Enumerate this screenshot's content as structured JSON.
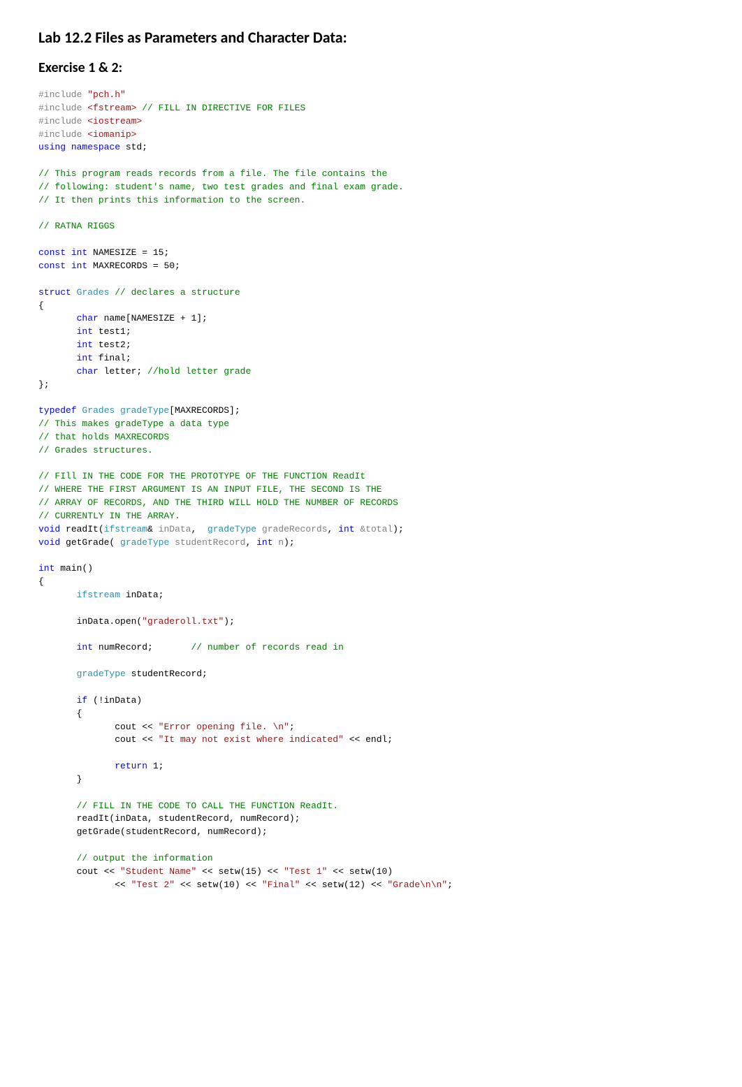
{
  "title": "Lab 12.2 Files as Parameters and Character Data:",
  "subtitle": "Exercise 1 & 2:",
  "code": {
    "l1a": "#include",
    "l1b": " \"pch.h\"",
    "l2a": "#include",
    "l2b": " <fstream>",
    "l2c": " // FILL IN DIRECTIVE FOR FILES",
    "l3a": "#include",
    "l3b": " <iostream>",
    "l4a": "#include",
    "l4b": " <iomanip>",
    "l5a": "using",
    "l5b": " namespace",
    "l5c": " std;",
    "c1": "// This program reads records from a file. The file contains the",
    "c2": "// following: student's name, two test grades and final exam grade.",
    "c3": "// It then prints this information to the screen.",
    "c4": "// RATNA RIGGS",
    "k_const": "const",
    "k_int": "int",
    "ns": " NAMESIZE = 15;",
    "mr": " MAXRECORDS = 50;",
    "k_struct": "struct",
    "t_grades": " Grades",
    "c5": " // declares a structure",
    "ob": "{",
    "k_char": "char",
    "nm": " name[NAMESIZE + 1];",
    "t1": " test1;",
    "t2": " test2;",
    "fn": " final;",
    "lt": " letter;",
    "c6": " //hold letter grade",
    "cb": "};",
    "k_typedef": "typedef",
    "t_gradeType": " gradeType",
    "arr": "[MAXRECORDS];",
    "c7": "// This makes gradeType a data type",
    "c8": "// that holds MAXRECORDS",
    "c9": "// Grades structures.",
    "c10": "// FIll IN THE CODE FOR THE PROTOTYPE OF THE FUNCTION ReadIt",
    "c11": "// WHERE THE FIRST ARGUMENT IS AN INPUT FILE, THE SECOND IS THE",
    "c12": "// ARRAY OF RECORDS, AND THE THIRD WILL HOLD THE NUMBER OF RECORDS",
    "c13": "// CURRENTLY IN THE ARRAY.",
    "k_void": "void",
    "readit": " readIt(",
    "t_ifstream": "ifstream",
    "amp": "& ",
    "p_inData": "inData",
    "comma": ", ",
    "p_gr": "gradeRecords",
    "p_total": " &total",
    "rp": ");",
    "getgrade": " getGrade(",
    "p_sr": "studentRecord",
    "p_n": " n",
    "main": " main()",
    "ob2": "{",
    "t_ifstream2": "ifstream",
    "inDataDecl": " inData;",
    "open1": "       inData.open(",
    "s_file": "\"graderoll.txt\"",
    "open2": ");",
    "numrec": " numRecord;",
    "c14": "       // number of records read in",
    "t_gradeType2": "gradeType",
    "srDecl": " studentRecord;",
    "k_if": "if",
    "ifcond": " (!inData)",
    "ob3": "       {",
    "cout1a": "              cout << ",
    "s_err1": "\"Error opening file. \\n\"",
    "semi": ";",
    "cout2a": "              cout << ",
    "s_err2": "\"It may not exist where indicated\"",
    "endl": " << endl;",
    "k_return": "return",
    "ret1": " 1;",
    "cb3": "       }",
    "c15": "       // FILL IN THE CODE TO CALL THE FUNCTION ReadIt.",
    "call1": "       readIt(inData, studentRecord, numRecord);",
    "call2": "       getGrade(studentRecord, numRecord);",
    "c16": "       // output the information",
    "cout3a": "       cout << ",
    "s1": "\"Student Name\"",
    "sw1": " << setw(15) << ",
    "s2": "\"Test 1\"",
    "sw2": " << setw(10)",
    "cout3b": "              << ",
    "s3": "\"Test 2\"",
    "sw3": " << setw(10) << ",
    "s4": "\"Final\"",
    "sw4": " << setw(12) << ",
    "s5": "\"Grade\\n\\n\""
  }
}
